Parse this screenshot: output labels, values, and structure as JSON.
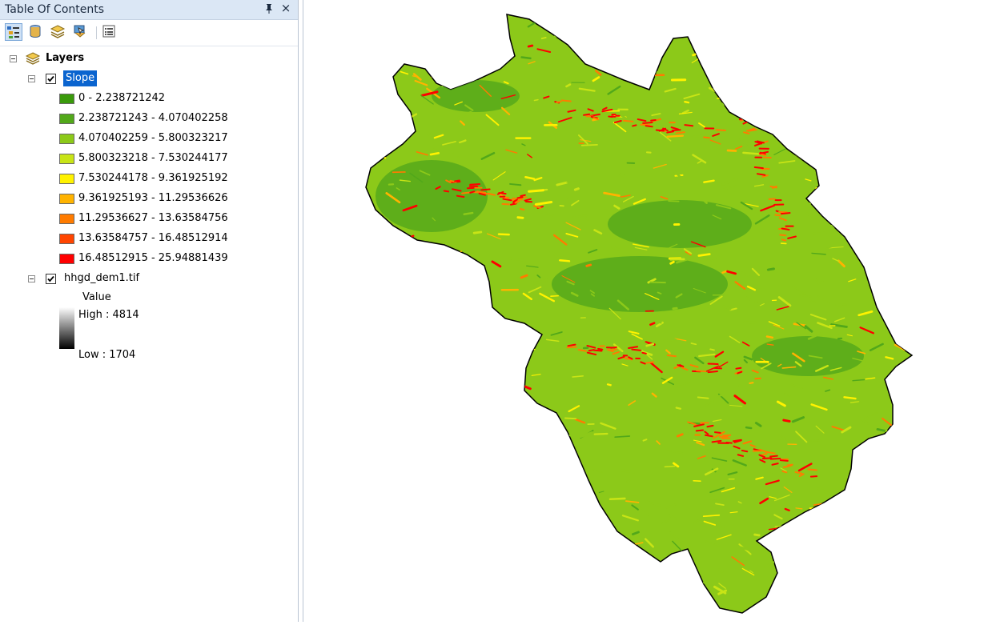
{
  "toc": {
    "title": "Table Of Contents",
    "pin_icon": "pin-icon",
    "close_glyph": "×",
    "toolbar": [
      {
        "name": "list-by-drawing-order-icon",
        "active": true
      },
      {
        "name": "list-by-source-icon",
        "active": false
      },
      {
        "name": "list-by-visibility-icon",
        "active": false
      },
      {
        "name": "list-by-selection-icon",
        "active": false
      },
      {
        "name": "options-icon",
        "active": false
      }
    ],
    "root": {
      "label": "Layers",
      "expanded": true
    },
    "layers": [
      {
        "label": "Slope",
        "checked": true,
        "selected": true,
        "classes": [
          {
            "label": "0 - 2.238721242",
            "color": "#3a9a0b"
          },
          {
            "label": "2.238721243 - 4.070402258",
            "color": "#52a81a"
          },
          {
            "label": "4.070402259 - 5.800323217",
            "color": "#8cc919"
          },
          {
            "label": "5.800323218 - 7.530244177",
            "color": "#c8e416"
          },
          {
            "label": "7.530244178 - 9.361925192",
            "color": "#fff200"
          },
          {
            "label": "9.361925193 - 11.29536626",
            "color": "#ffb300"
          },
          {
            "label": "11.29536627 - 13.63584756",
            "color": "#ff7b00"
          },
          {
            "label": "13.63584757 - 16.48512914",
            "color": "#ff4500"
          },
          {
            "label": "16.48512915 - 25.94881439",
            "color": "#ff0000"
          }
        ]
      },
      {
        "label": "hhgd_dem1.tif",
        "checked": true,
        "selected": false,
        "value_label": "Value",
        "high_label": "High : 4814",
        "low_label": "Low : 1704"
      }
    ]
  },
  "colors": {
    "selection": "#0a64cf",
    "slope_low": "#3a9a0b",
    "slope_mid": "#8cc919",
    "slope_yellow": "#fff200",
    "slope_high": "#ff0000"
  }
}
